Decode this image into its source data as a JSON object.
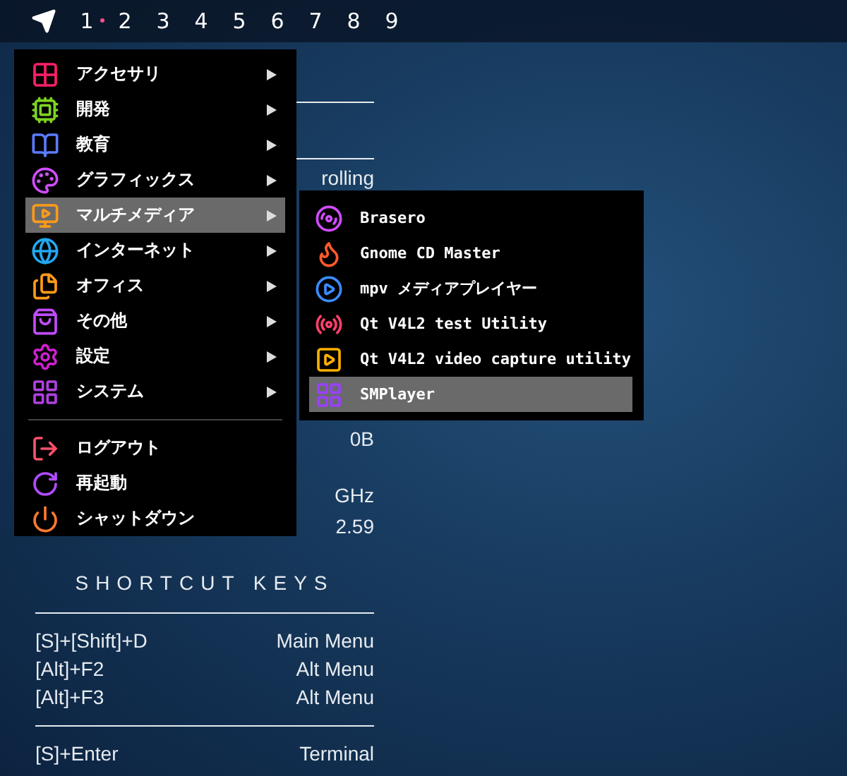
{
  "top_bar": {
    "workspaces": [
      {
        "label": "1",
        "selected": true
      },
      {
        "label": "2",
        "selected": false
      },
      {
        "label": "3",
        "selected": false
      },
      {
        "label": "4",
        "selected": false
      },
      {
        "label": "5",
        "selected": false
      },
      {
        "label": "6",
        "selected": false
      },
      {
        "label": "7",
        "selected": false
      },
      {
        "label": "8",
        "selected": false
      },
      {
        "label": "9",
        "selected": false
      }
    ]
  },
  "system_info": {
    "line_2": "rolling",
    "line_3": "0B",
    "line_4": "GHz",
    "line_5": "2.59"
  },
  "shortcut_keys": {
    "title": "SHORTCUT KEYS",
    "groups": [
      [
        {
          "keys": "[S]+[Shift]+D",
          "action": "Main Menu"
        },
        {
          "keys": "[Alt]+F2",
          "action": "Alt Menu"
        },
        {
          "keys": "[Alt]+F3",
          "action": "Alt Menu"
        }
      ],
      [
        {
          "keys": "[S]+Enter",
          "action": "Terminal"
        }
      ]
    ]
  },
  "menu": {
    "sections": [
      [
        {
          "label": "アクセサリ",
          "kind": "submenu",
          "selected": false
        },
        {
          "label": "開発",
          "kind": "submenu",
          "selected": false
        },
        {
          "label": "教育",
          "kind": "submenu",
          "selected": false
        },
        {
          "label": "グラフィックス",
          "kind": "submenu",
          "selected": false
        },
        {
          "label": "マルチメディア",
          "kind": "submenu",
          "selected": true
        },
        {
          "label": "インターネット",
          "kind": "submenu",
          "selected": false
        },
        {
          "label": "オフィス",
          "kind": "submenu",
          "selected": false
        },
        {
          "label": "その他",
          "kind": "submenu",
          "selected": false
        },
        {
          "label": "設定",
          "kind": "submenu",
          "selected": false
        },
        {
          "label": "システム",
          "kind": "submenu",
          "selected": false
        }
      ],
      [
        {
          "label": "ログアウト",
          "kind": "action",
          "selected": false
        },
        {
          "label": "再起動",
          "kind": "action",
          "selected": false
        },
        {
          "label": "シャットダウン",
          "kind": "action",
          "selected": false
        }
      ]
    ]
  },
  "submenu": {
    "items": [
      {
        "label": "Brasero",
        "selected": false
      },
      {
        "label": "Gnome CD Master",
        "selected": false
      },
      {
        "label": "mpv メディアプレイヤー",
        "selected": false
      },
      {
        "label": "Qt V4L2 test Utility",
        "selected": false
      },
      {
        "label": "Qt V4L2 video capture utility",
        "selected": false
      },
      {
        "label": "SMPlayer",
        "selected": true
      }
    ]
  }
}
